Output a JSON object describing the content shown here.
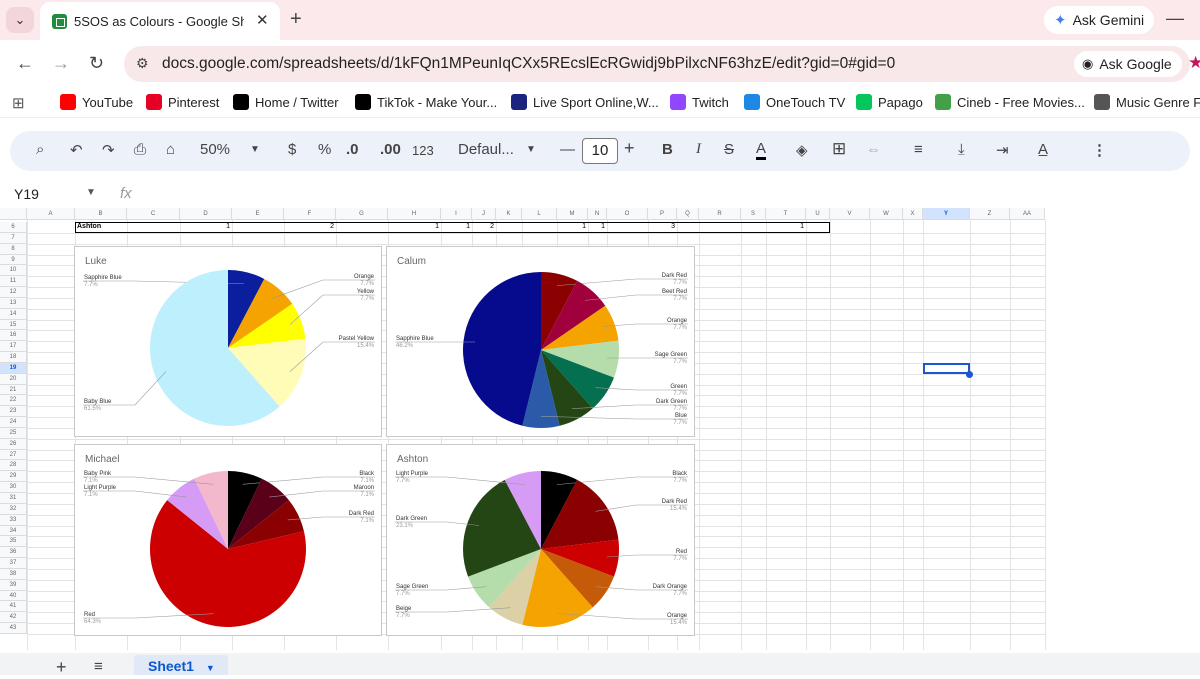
{
  "browser": {
    "tab_title": "5SOS as Colours - Google Sheets",
    "ask_gemini": "Ask Gemini",
    "url": "docs.google.com/spreadsheets/d/1kFQn1MPeunIqCXx5REcslEcRGwidj9bPilxcNF63hzE/edit?gid=0#gid=0",
    "ask_google": "Ask Google",
    "bookmarks": [
      {
        "label": "YouTube",
        "icon": "youtube-icon",
        "color": "#ff0000"
      },
      {
        "label": "Pinterest",
        "icon": "pinterest-icon",
        "color": "#e60023"
      },
      {
        "label": "Home / Twitter",
        "icon": "x-icon",
        "color": "#000000"
      },
      {
        "label": "TikTok - Make Your...",
        "icon": "tiktok-icon",
        "color": "#000000"
      },
      {
        "label": "Live Sport Online,W...",
        "icon": "livesport-icon",
        "color": "#1a237e"
      },
      {
        "label": "Twitch",
        "icon": "twitch-icon",
        "color": "#9146ff"
      },
      {
        "label": "OneTouch TV",
        "icon": "onetouch-icon",
        "color": "#1e88e5"
      },
      {
        "label": "Papago",
        "icon": "papago-icon",
        "color": "#03c75a"
      },
      {
        "label": "Cineb - Free Movies...",
        "icon": "cineb-icon",
        "color": "#43a047"
      },
      {
        "label": "Music Genre Fir",
        "icon": "music-icon",
        "color": "#555555"
      }
    ]
  },
  "toolbar": {
    "zoom": "50%",
    "currency": "$",
    "percent": "%",
    "dec_decrease": ".0",
    "dec_increase": ".00",
    "format_123": "123",
    "font": "Defaul...",
    "font_size": "10",
    "bold": "B",
    "italic": "I",
    "text_color": "A"
  },
  "formula_bar": {
    "cell_ref": "Y19",
    "fx": "fx"
  },
  "grid": {
    "columns": [
      "A",
      "B",
      "C",
      "D",
      "E",
      "F",
      "G",
      "H",
      "I",
      "J",
      "K",
      "L",
      "M",
      "N",
      "O",
      "P",
      "Q",
      "R",
      "S",
      "T",
      "U",
      "V",
      "W",
      "X",
      "Y",
      "Z",
      "AA"
    ],
    "rows": [
      "6",
      "7",
      "8",
      "9",
      "10",
      "11",
      "12",
      "13",
      "14",
      "15",
      "16",
      "17",
      "18",
      "19",
      "20",
      "21",
      "22",
      "23",
      "24",
      "25",
      "26",
      "27",
      "28",
      "29",
      "30",
      "31",
      "32",
      "33",
      "34",
      "35",
      "36",
      "37",
      "38",
      "39",
      "40",
      "41",
      "42",
      "43"
    ],
    "selected_row": "19",
    "selected_col": "Y",
    "row6": {
      "name": "Ashton",
      "values": [
        "1",
        "2",
        "1",
        "1",
        "2",
        "1",
        "1",
        "3",
        "1"
      ]
    }
  },
  "chart_data": [
    {
      "type": "pie",
      "title": "Luke",
      "slices": [
        {
          "name": "Sapphire Blue",
          "value": 7.7,
          "label": "7.7%",
          "color": "#0a1e9e"
        },
        {
          "name": "Orange",
          "value": 7.7,
          "label": "7.7%",
          "color": "#f5a300"
        },
        {
          "name": "Yellow",
          "value": 7.7,
          "label": "7.7%",
          "color": "#ffff00"
        },
        {
          "name": "Pastel Yellow",
          "value": 15.4,
          "label": "15.4%",
          "color": "#fffcb8"
        },
        {
          "name": "Baby Blue",
          "value": 61.5,
          "label": "61.5%",
          "color": "#bdeffc"
        }
      ]
    },
    {
      "type": "pie",
      "title": "Calum",
      "slices": [
        {
          "name": "Dark Red",
          "value": 7.7,
          "label": "7.7%",
          "color": "#8b0000"
        },
        {
          "name": "Beet Red",
          "value": 7.7,
          "label": "7.7%",
          "color": "#a0003c"
        },
        {
          "name": "Orange",
          "value": 7.7,
          "label": "7.7%",
          "color": "#f5a300"
        },
        {
          "name": "Sage Green",
          "value": 7.7,
          "label": "7.7%",
          "color": "#b5dcab"
        },
        {
          "name": "Green",
          "value": 7.7,
          "label": "7.7%",
          "color": "#04704f"
        },
        {
          "name": "Dark Green",
          "value": 7.7,
          "label": "7.7%",
          "color": "#234614"
        },
        {
          "name": "Blue",
          "value": 7.7,
          "label": "7.7%",
          "color": "#2a5aa8"
        },
        {
          "name": "Sapphire Blue",
          "value": 46.2,
          "label": "46.2%",
          "color": "#060a8c"
        }
      ]
    },
    {
      "type": "pie",
      "title": "Michael",
      "slices": [
        {
          "name": "Black",
          "value": 7.1,
          "label": "7.1%",
          "color": "#000000"
        },
        {
          "name": "Maroon",
          "value": 7.1,
          "label": "7.1%",
          "color": "#5a0019"
        },
        {
          "name": "Dark Red",
          "value": 7.1,
          "label": "7.1%",
          "color": "#8b0000"
        },
        {
          "name": "Red",
          "value": 64.3,
          "label": "64.3%",
          "color": "#cc0000"
        },
        {
          "name": "Light Purple",
          "value": 7.1,
          "label": "7.1%",
          "color": "#d69cf5"
        },
        {
          "name": "Baby Pink",
          "value": 7.1,
          "label": "7.1%",
          "color": "#f4b8cc"
        }
      ]
    },
    {
      "type": "pie",
      "title": "Ashton",
      "slices": [
        {
          "name": "Black",
          "value": 7.7,
          "label": "7.7%",
          "color": "#000000"
        },
        {
          "name": "Dark Red",
          "value": 15.4,
          "label": "15.4%",
          "color": "#8b0000"
        },
        {
          "name": "Red",
          "value": 7.7,
          "label": "7.7%",
          "color": "#cc0000"
        },
        {
          "name": "Dark Orange",
          "value": 7.7,
          "label": "7.7%",
          "color": "#c55a08"
        },
        {
          "name": "Orange",
          "value": 15.4,
          "label": "15.4%",
          "color": "#f5a300"
        },
        {
          "name": "Beige",
          "value": 7.7,
          "label": "7.7%",
          "color": "#dcd0a6"
        },
        {
          "name": "Sage Green",
          "value": 7.7,
          "label": "7.7%",
          "color": "#b5dcab"
        },
        {
          "name": "Dark Green",
          "value": 23.1,
          "label": "23.1%",
          "color": "#234614"
        },
        {
          "name": "Light Purple",
          "value": 7.7,
          "label": "7.7%",
          "color": "#d69cf5"
        }
      ]
    }
  ],
  "sheets": {
    "active": "Sheet1"
  }
}
